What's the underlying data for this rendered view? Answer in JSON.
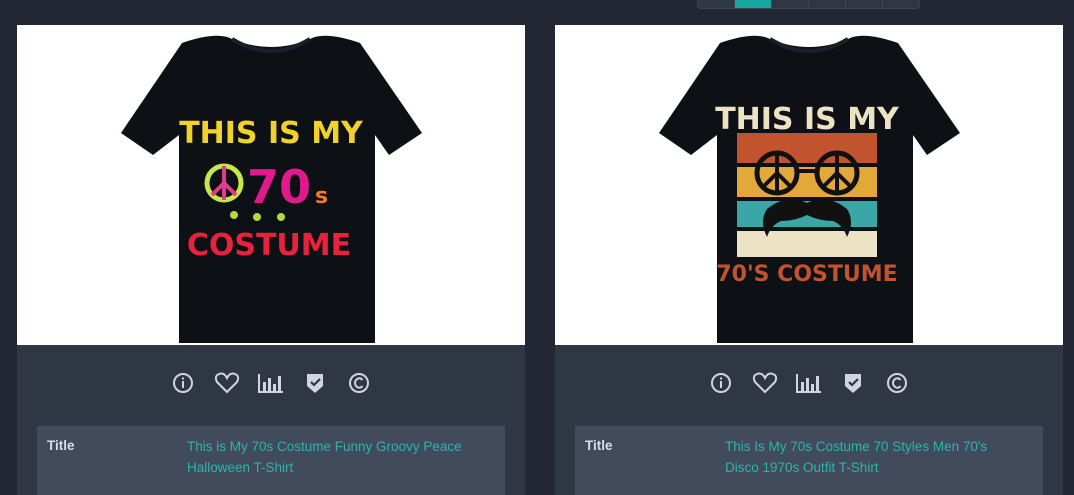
{
  "pagination": {
    "pages": 6,
    "active_index": 1
  },
  "colors": {
    "accent": "#1aa6a0",
    "background": "#222733",
    "card": "#2f3644",
    "info_row": "#414b5c",
    "link": "#2bb6aa"
  },
  "actions": [
    {
      "icon": "info-icon"
    },
    {
      "icon": "heart-icon"
    },
    {
      "icon": "bar-chart-icon"
    },
    {
      "icon": "shield-check-icon"
    },
    {
      "icon": "copyright-icon"
    }
  ],
  "products": [
    {
      "field_label": "Title",
      "title_line1": "This is My 70s Costume Funny Groovy Peace",
      "title_line2": "Halloween T-Shirt",
      "shirt": {
        "top": "THIS IS MY",
        "middle": "70",
        "middle_suffix": "s",
        "bottom": "COSTUME"
      }
    },
    {
      "field_label": "Title",
      "title_line1": "This Is My 70s Costume 70 Styles Men 70's",
      "title_line2": "Disco 1970s Outfit T-Shirt",
      "shirt": {
        "top": "THIS IS MY",
        "bottom": "70'S COSTUME"
      }
    }
  ]
}
